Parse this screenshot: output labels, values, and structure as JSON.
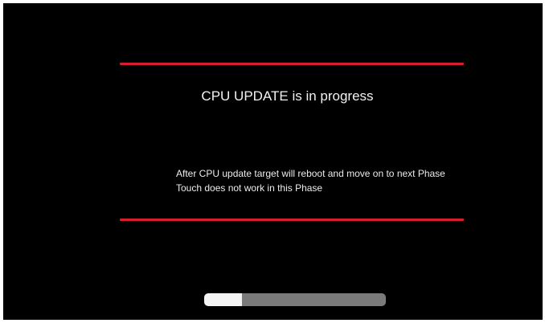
{
  "screen": {
    "title": "CPU UPDATE is in progress",
    "message_lines": [
      "After CPU update target will reboot and move on to next Phase",
      "Touch does not work in this Phase"
    ]
  },
  "progress": {
    "fraction": 0.21
  },
  "colors": {
    "background": "#000000",
    "accent_line": "#d81e2c",
    "text": "#f2f2f2",
    "progress_track": "#7a7a7a",
    "progress_fill": "#f4f4f4"
  }
}
